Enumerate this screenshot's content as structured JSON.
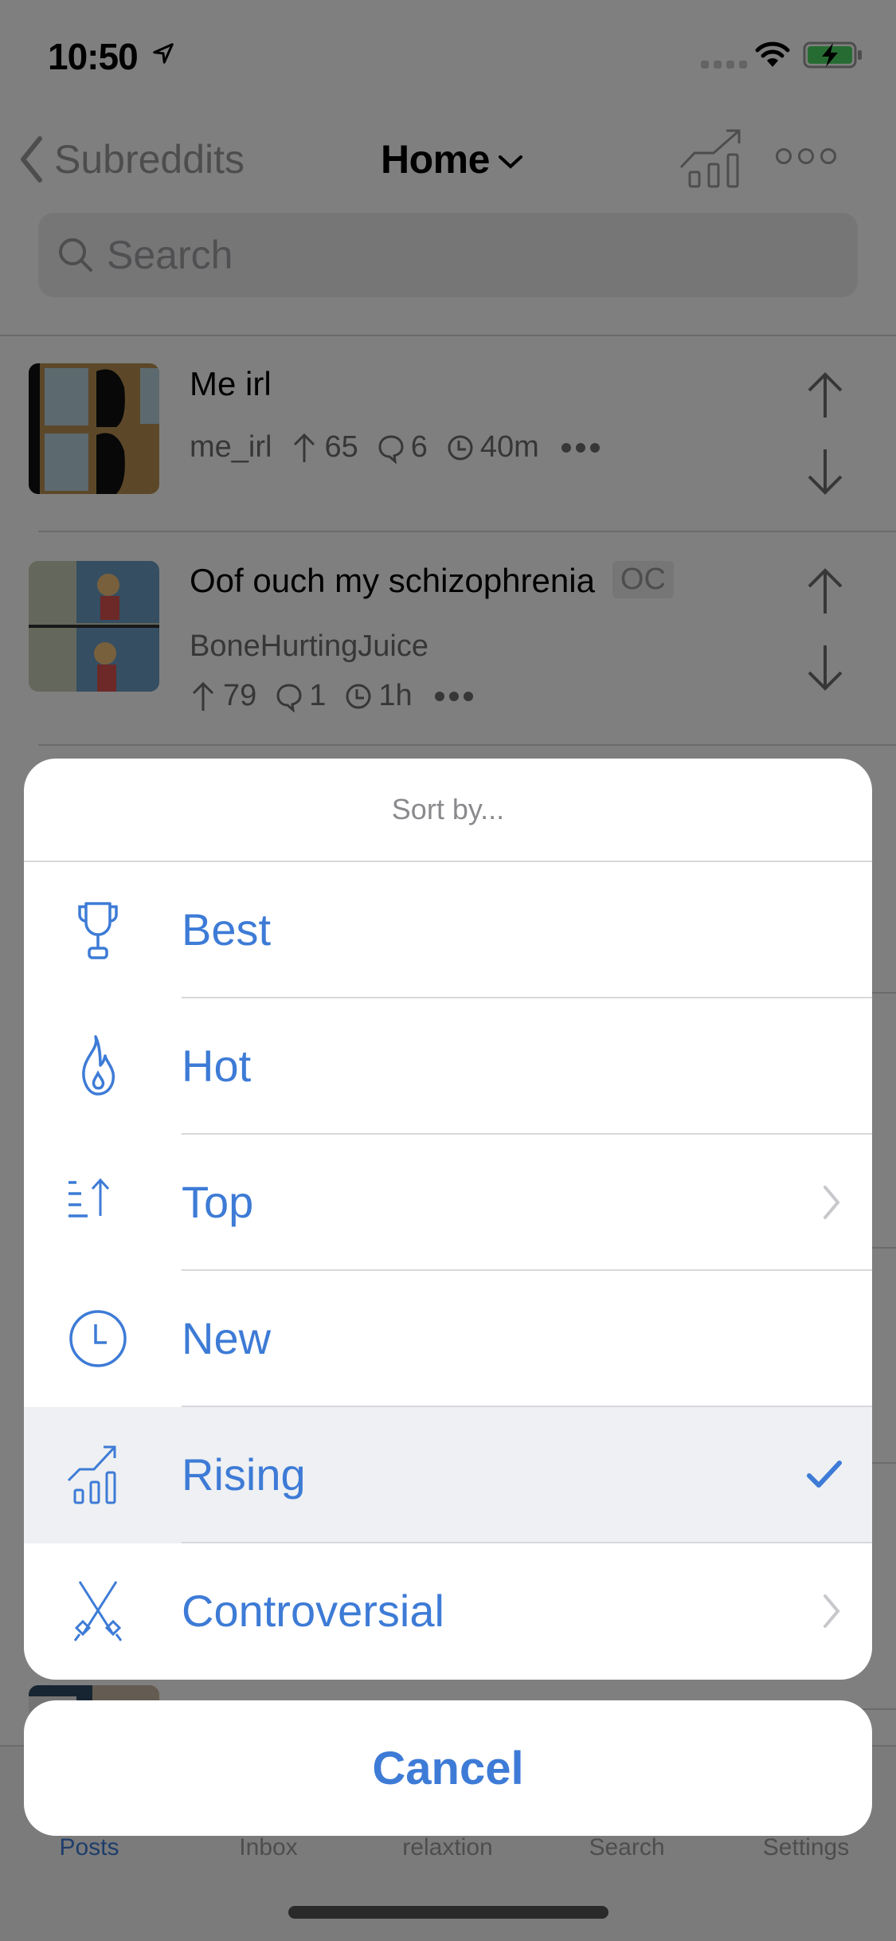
{
  "status_bar": {
    "time": "10:50",
    "battery_color": "#4cd964"
  },
  "nav": {
    "back_label": "Subreddits",
    "title": "Home"
  },
  "search": {
    "placeholder": "Search"
  },
  "posts": [
    {
      "title": "Me irl",
      "subreddit": "me_irl",
      "upvotes": "65",
      "comments": "6",
      "age": "40m",
      "badge": ""
    },
    {
      "title": "Oof ouch my schizophrenia",
      "badge": "OC",
      "subreddit": "BoneHurtingJuice",
      "upvotes": "79",
      "comments": "1",
      "age": "1h"
    }
  ],
  "tab_bar": {
    "items": [
      {
        "label": "Posts",
        "active": true
      },
      {
        "label": "Inbox",
        "active": false
      },
      {
        "label": "relaxtion",
        "active": false
      },
      {
        "label": "Search",
        "active": false
      },
      {
        "label": "Settings",
        "active": false
      }
    ]
  },
  "sort_sheet": {
    "title": "Sort by...",
    "accent_color": "#3d7bd6",
    "options": [
      {
        "label": "Best",
        "icon": "trophy-icon",
        "has_submenu": false,
        "selected": false
      },
      {
        "label": "Hot",
        "icon": "flame-icon",
        "has_submenu": false,
        "selected": false
      },
      {
        "label": "Top",
        "icon": "sort-up-icon",
        "has_submenu": true,
        "selected": false
      },
      {
        "label": "New",
        "icon": "clock-icon",
        "has_submenu": false,
        "selected": false
      },
      {
        "label": "Rising",
        "icon": "rising-chart-icon",
        "has_submenu": false,
        "selected": true
      },
      {
        "label": "Controversial",
        "icon": "crossed-swords-icon",
        "has_submenu": true,
        "selected": false
      }
    ],
    "cancel_label": "Cancel"
  }
}
